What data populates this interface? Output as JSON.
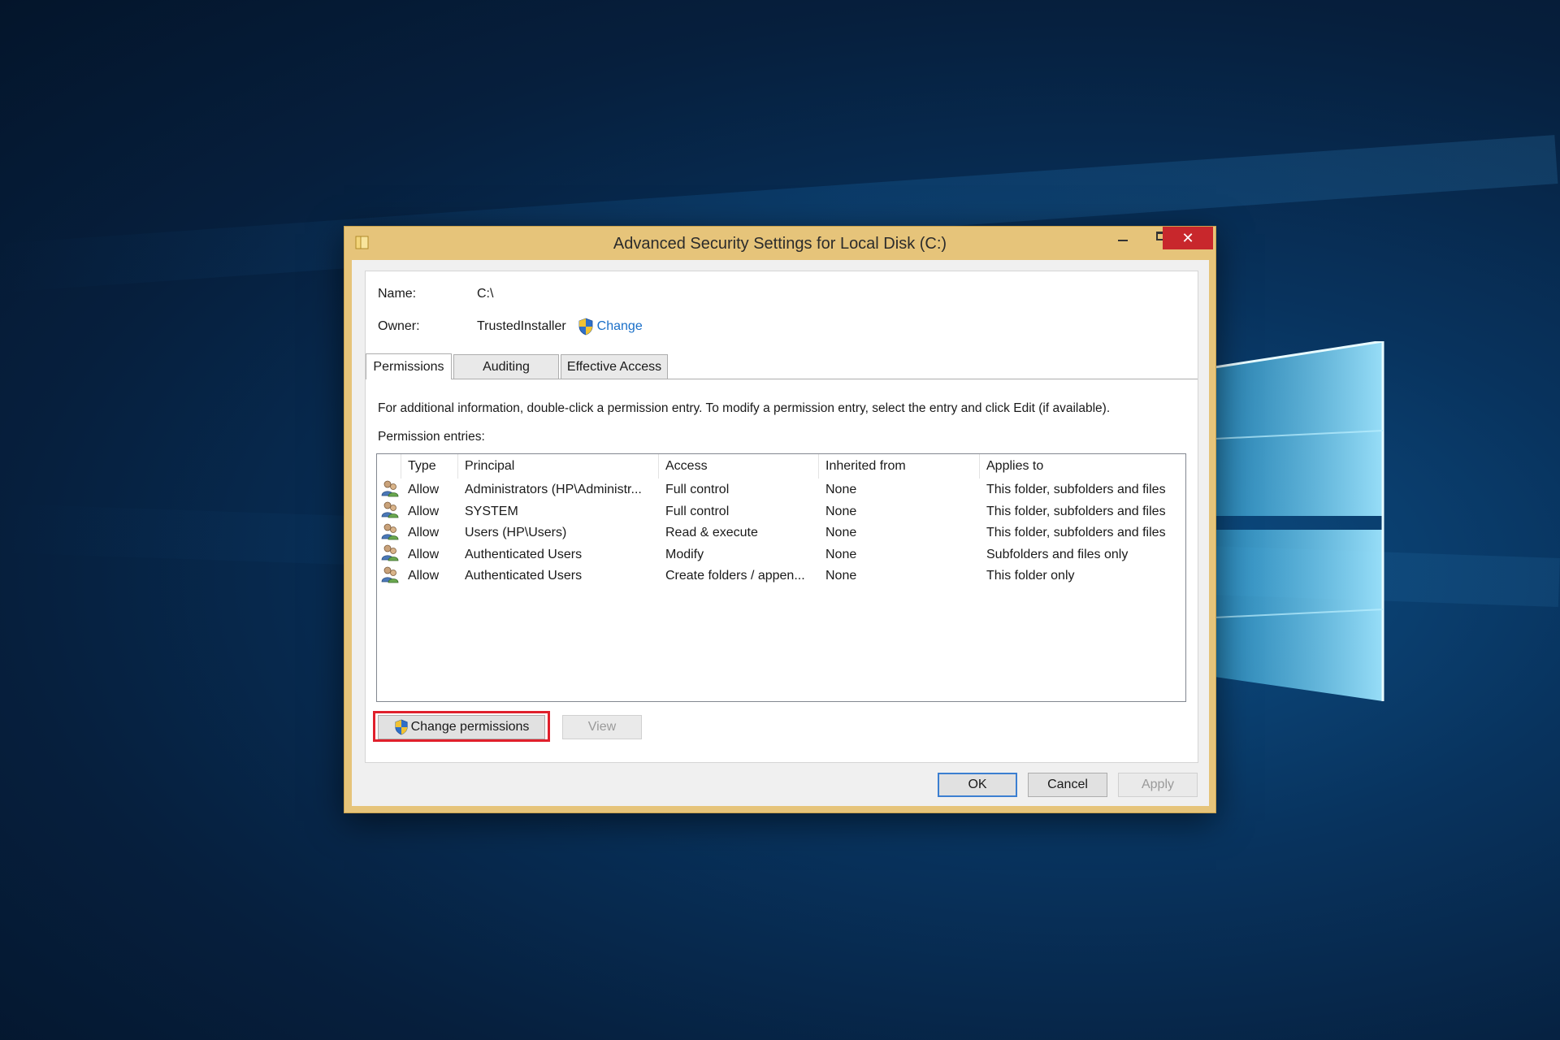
{
  "window": {
    "title": "Advanced Security Settings for Local Disk (C:)",
    "close_glyph": "✕"
  },
  "object": {
    "name_label": "Name:",
    "name_value": "C:\\",
    "owner_label": "Owner:",
    "owner_value": "TrustedInstaller",
    "owner_change_link": "Change"
  },
  "tabs": [
    {
      "label": "Permissions",
      "active": true
    },
    {
      "label": "Auditing",
      "active": false
    },
    {
      "label": "Effective Access",
      "active": false
    }
  ],
  "permissions": {
    "info_text": "For additional information, double-click a permission entry. To modify a permission entry, select the entry and click Edit (if available).",
    "entries_label": "Permission entries:",
    "columns": [
      "Type",
      "Principal",
      "Access",
      "Inherited from",
      "Applies to"
    ],
    "rows": [
      {
        "type": "Allow",
        "principal": "Administrators (HP\\Administr...",
        "access": "Full control",
        "inherited_from": "None",
        "applies_to": "This folder, subfolders and files"
      },
      {
        "type": "Allow",
        "principal": "SYSTEM",
        "access": "Full control",
        "inherited_from": "None",
        "applies_to": "This folder, subfolders and files"
      },
      {
        "type": "Allow",
        "principal": "Users (HP\\Users)",
        "access": "Read & execute",
        "inherited_from": "None",
        "applies_to": "This folder, subfolders and files"
      },
      {
        "type": "Allow",
        "principal": "Authenticated Users",
        "access": "Modify",
        "inherited_from": "None",
        "applies_to": "Subfolders and files only"
      },
      {
        "type": "Allow",
        "principal": "Authenticated Users",
        "access": "Create folders / appen...",
        "inherited_from": "None",
        "applies_to": "This folder only"
      }
    ],
    "change_permissions_button": "Change permissions",
    "view_button": "View"
  },
  "footer": {
    "ok": "OK",
    "cancel": "Cancel",
    "apply": "Apply"
  },
  "colors": {
    "window_frame": "#e6c47a",
    "close_button": "#c8272c",
    "link": "#1a6fc8",
    "highlight_box": "#e0202c",
    "default_button_border": "#3c7fd1"
  },
  "icons": {
    "title": "folder-icon",
    "uac": "uac-shield-icon",
    "principal": "users-icon",
    "background": "windows-logo-icon"
  }
}
